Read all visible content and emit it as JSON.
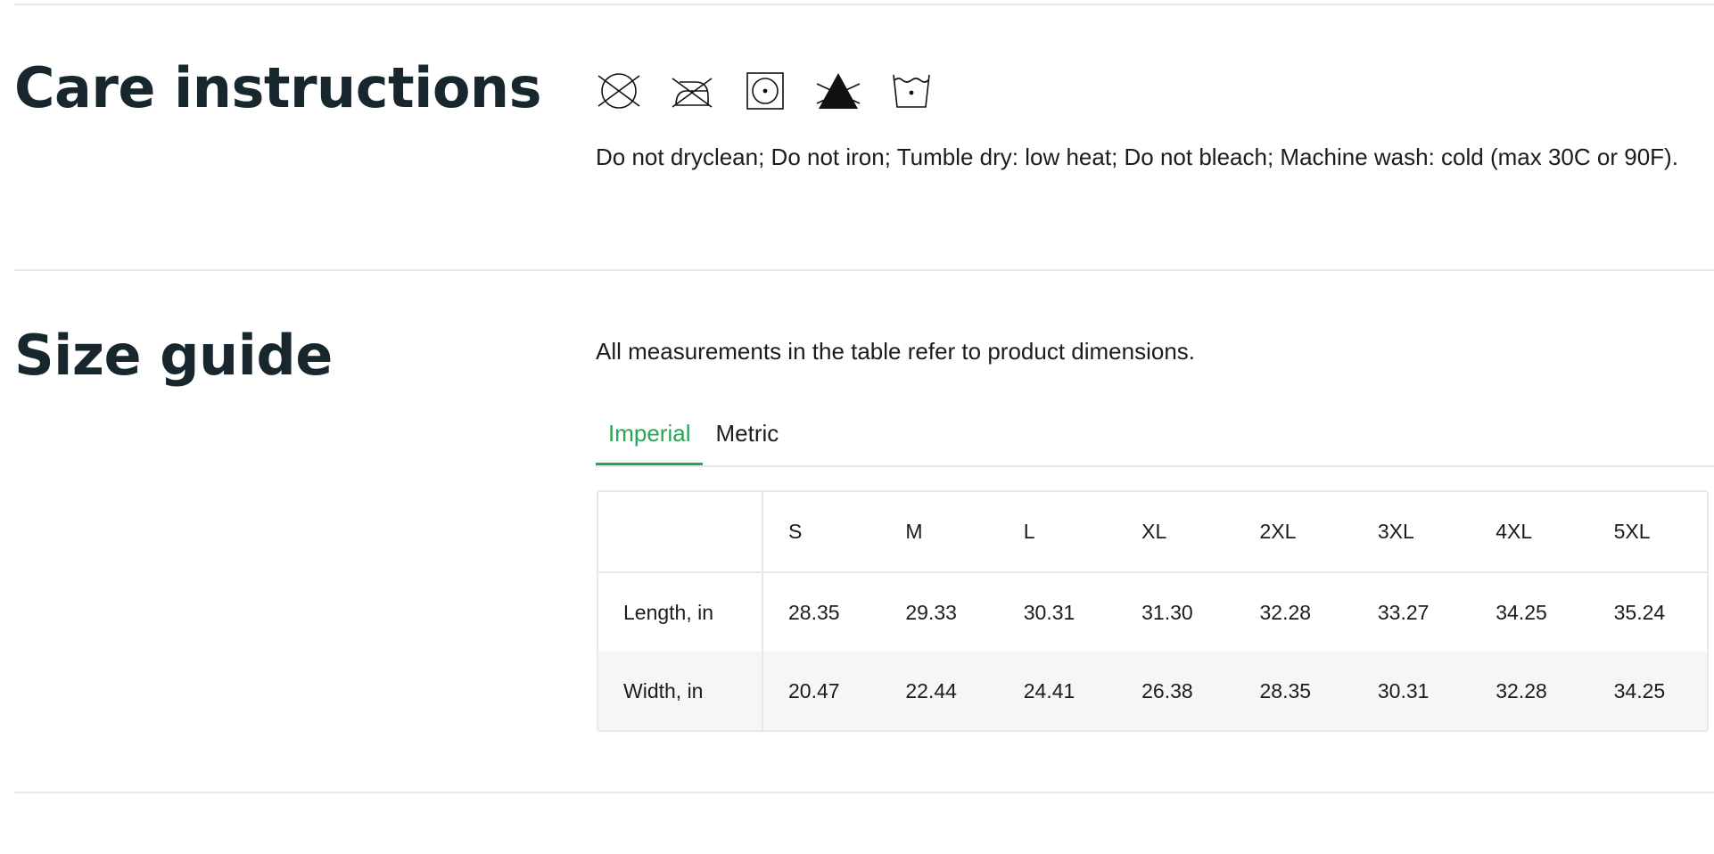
{
  "care": {
    "title": "Care instructions",
    "icons": [
      "do-not-dryclean-icon",
      "do-not-iron-icon",
      "tumble-dry-low-heat-icon",
      "do-not-bleach-icon",
      "machine-wash-cold-icon"
    ],
    "description": "Do not dryclean; Do not iron; Tumble dry: low heat; Do not bleach; Machine wash: cold (max 30C or 90F)."
  },
  "size_guide": {
    "title": "Size guide",
    "intro": "All measurements in the table refer to product dimensions.",
    "tabs": [
      {
        "label": "Imperial",
        "active": true
      },
      {
        "label": "Metric",
        "active": false
      }
    ],
    "table": {
      "columns": [
        "S",
        "M",
        "L",
        "XL",
        "2XL",
        "3XL",
        "4XL",
        "5XL"
      ],
      "rows": [
        {
          "label": "Length, in",
          "values": [
            "28.35",
            "29.33",
            "30.31",
            "31.30",
            "32.28",
            "33.27",
            "34.25",
            "35.24"
          ]
        },
        {
          "label": "Width, in",
          "values": [
            "20.47",
            "22.44",
            "24.41",
            "26.38",
            "28.35",
            "30.31",
            "32.28",
            "34.25"
          ]
        }
      ]
    }
  },
  "colors": {
    "accent": "#29a551",
    "heading": "#18262e",
    "divider": "#e6e8e9",
    "row_alt": "#f6f6f6"
  }
}
